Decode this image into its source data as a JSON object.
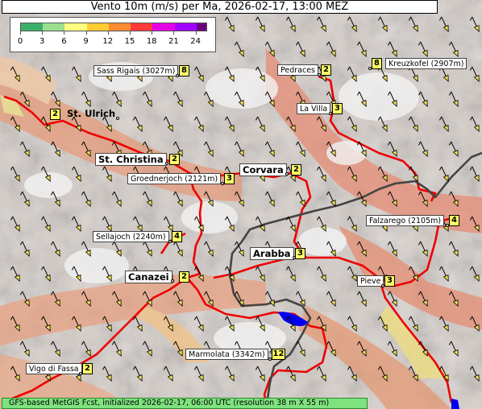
{
  "title": "Vento 10m (m/s) per Ma, 2026-02-17, 13:00 MEZ",
  "legend": {
    "ticks": [
      "0",
      "3",
      "6",
      "9",
      "12",
      "15",
      "18",
      "21",
      "24"
    ],
    "colors": [
      "#3cb06a",
      "#9be08c",
      "#ffff80",
      "#ffcc33",
      "#ff8c33",
      "#ff3a3a",
      "#e600e6",
      "#a000ff",
      "#6a0080"
    ]
  },
  "places": [
    {
      "name": "Sass Rigais (3027m)",
      "value": "8",
      "type": "peak"
    },
    {
      "name": "Pedraces",
      "value": "2",
      "type": "village"
    },
    {
      "name": "Kreuzkofel (2907m)",
      "value": "8",
      "type": "peak"
    },
    {
      "name": "St. Ulrich",
      "value": "2",
      "type": "town"
    },
    {
      "name": "La Villa",
      "value": "3",
      "type": "village"
    },
    {
      "name": "St. Christina",
      "value": "2",
      "type": "town"
    },
    {
      "name": "Corvara",
      "value": "2",
      "type": "town"
    },
    {
      "name": "Groednerjoch (2121m)",
      "value": "3",
      "type": "pass"
    },
    {
      "name": "Falzarego (2105m)",
      "value": "4",
      "type": "pass"
    },
    {
      "name": "Sellajoch (2240m)",
      "value": "4",
      "type": "pass"
    },
    {
      "name": "Arabba",
      "value": "3",
      "type": "town"
    },
    {
      "name": "Canazei",
      "value": "2",
      "type": "town"
    },
    {
      "name": "Pieve",
      "value": "3",
      "type": "village"
    },
    {
      "name": "Marmolata (3342m)",
      "value": "12",
      "type": "peak"
    },
    {
      "name": "Vigo di Fassa",
      "value": "2",
      "type": "village"
    }
  ],
  "footer": "GFS-based MetGIS Fcst, initialized 2026-02-17, 06:00 UTC  (resolution 38 m X 55 m)",
  "colors": {
    "roads": "#ee0000",
    "main_road": "#444444",
    "water": "#0000ee",
    "badge": "#ffff66",
    "footer": "#7ee27e"
  }
}
